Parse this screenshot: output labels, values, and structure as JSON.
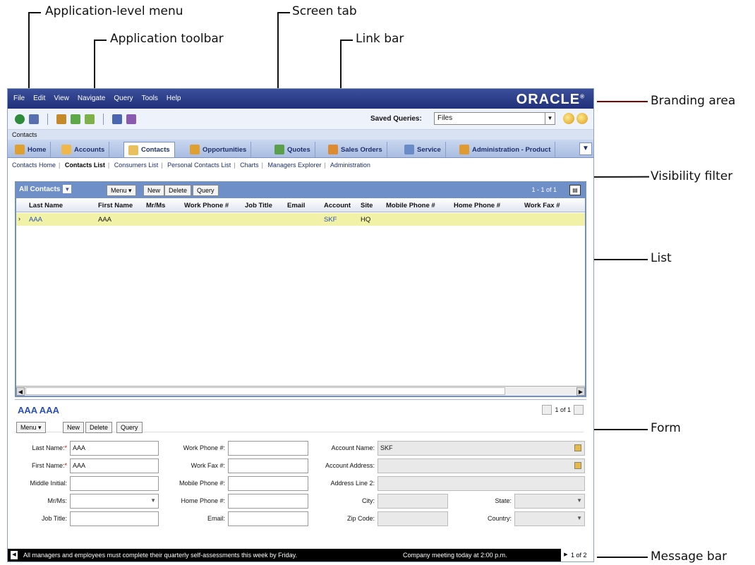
{
  "callouts": {
    "app_menu": "Application-level menu",
    "app_toolbar": "Application toolbar",
    "screen_tab": "Screen tab",
    "link_bar": "Link bar",
    "branding_area": "Branding area",
    "visibility_filter": "Visibility filter",
    "list": "List",
    "form": "Form",
    "message_bar": "Message bar"
  },
  "menubar": {
    "items": [
      "File",
      "Edit",
      "View",
      "Navigate",
      "Query",
      "Tools",
      "Help"
    ],
    "brand": "ORACLE"
  },
  "toolbar": {
    "saved_queries_label": "Saved Queries:",
    "saved_queries_value": "Files"
  },
  "context": "Contacts",
  "tabs": [
    {
      "label": "Home"
    },
    {
      "label": "Accounts"
    },
    {
      "label": "Contacts"
    },
    {
      "label": "Opportunities"
    },
    {
      "label": "Quotes"
    },
    {
      "label": "Sales Orders"
    },
    {
      "label": "Service"
    },
    {
      "label": "Administration - Product"
    }
  ],
  "linkbar": [
    "Contacts Home",
    "Contacts List",
    "Consumers List",
    "Personal Contacts List",
    "Charts",
    "Managers Explorer",
    "Administration"
  ],
  "list": {
    "visibility_filter": "All Contacts",
    "menu_label": "Menu",
    "new_label": "New",
    "delete_label": "Delete",
    "query_label": "Query",
    "record_count": "1 - 1 of 1",
    "columns": [
      "Last Name",
      "First Name",
      "Mr/Ms",
      "Work Phone #",
      "Job Title",
      "Email",
      "Account",
      "Site",
      "Mobile Phone #",
      "Home Phone #",
      "Work Fax #"
    ],
    "rows": [
      {
        "last_name": "AAA",
        "first_name": "AAA",
        "account": "SKF",
        "site": "HQ"
      }
    ]
  },
  "form": {
    "title": "AAA AAA",
    "nav": "1 of 1",
    "menu_label": "Menu",
    "new_label": "New",
    "delete_label": "Delete",
    "query_label": "Query",
    "labels": {
      "last_name": "Last Name:",
      "first_name": "First Name:",
      "middle_initial": "Middle Initial:",
      "mr_ms": "Mr/Ms:",
      "job_title": "Job Title:",
      "work_phone": "Work Phone #:",
      "work_fax": "Work Fax #:",
      "mobile_phone": "Mobile Phone #:",
      "home_phone": "Home Phone #:",
      "email": "Email:",
      "account_name": "Account Name:",
      "account_address": "Account Address:",
      "address_line2": "Address Line 2:",
      "city": "City:",
      "zip_code": "Zip Code:",
      "state": "State:",
      "country": "Country:"
    },
    "values": {
      "last_name": "AAA",
      "first_name": "AAA",
      "account_name": "SKF"
    }
  },
  "messagebar": {
    "text": "All managers and employees must complete their quarterly self-assessments this week by Friday.",
    "text2": "Company meeting today at 2:00 p.m.",
    "count": "1 of 2"
  }
}
